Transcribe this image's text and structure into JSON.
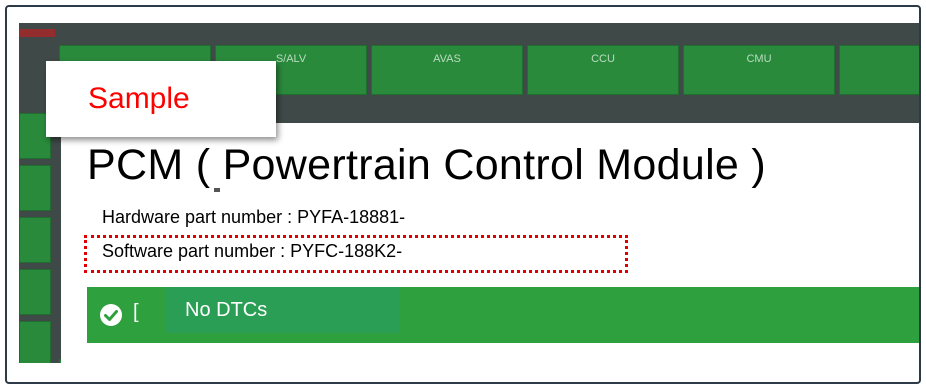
{
  "top_tabs": [
    {
      "label": "S/ALV"
    },
    {
      "label": "AVAS"
    },
    {
      "label": "CCU"
    },
    {
      "label": "CMU"
    },
    {
      "label": ""
    }
  ],
  "sample_label": "Sample",
  "module": {
    "title": "PCM ( Powertrain Control Module )",
    "hardware_part_number": "Hardware part number : PYFA-18881-",
    "software_part_number": "Software part number : PYFC-188K2-"
  },
  "status": {
    "letter": "[",
    "text": "No DTCs",
    "icon": "check-circle-icon"
  },
  "colors": {
    "accent_green": "#2ea03e",
    "highlight_red": "#e00000"
  }
}
